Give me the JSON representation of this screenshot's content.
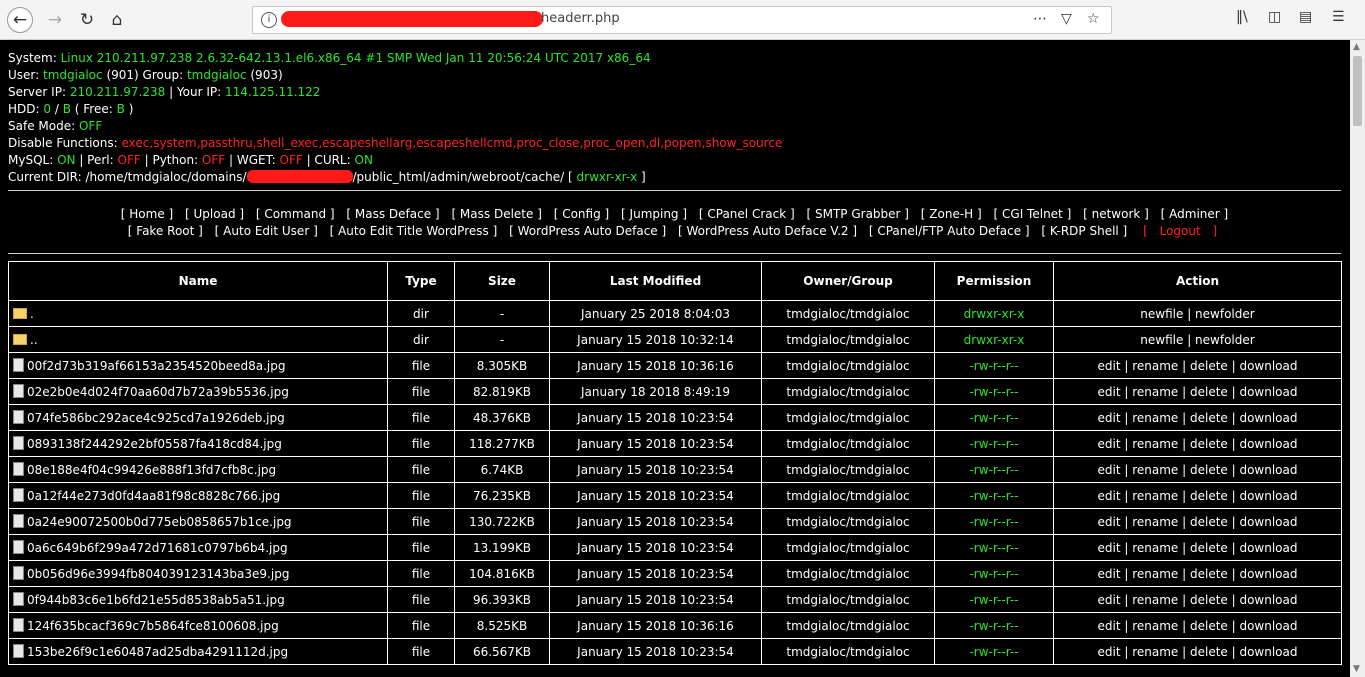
{
  "browser": {
    "url_suffix": "headerr.php",
    "icons": [
      "back-icon",
      "forward-icon",
      "reload-icon",
      "home-icon",
      "info-icon",
      "more-icon",
      "pocket-icon",
      "star-icon",
      "library-icon",
      "sidebar-icon",
      "reader-icon",
      "menu-icon"
    ]
  },
  "info": {
    "system_label": "System:",
    "system_value": "Linux 210.211.97.238 2.6.32-642.13.1.el6.x86_64 #1 SMP Wed Jan 11 20:56:24 UTC 2017 x86_64",
    "user_label": "User:",
    "user_value": "tmdgialoc",
    "user_id": "(901)",
    "group_label": "Group:",
    "group_value": "tmdgialoc",
    "group_id": "(903)",
    "server_ip_label": "Server IP:",
    "server_ip_value": "210.211.97.238",
    "your_ip_label": "| Your IP:",
    "your_ip_value": "114.125.11.122",
    "hdd_label": "HDD:",
    "hdd_used": "0",
    "hdd_sep": "/",
    "hdd_total": "B",
    "hdd_free_label": "( Free:",
    "hdd_free": "B",
    "hdd_close": ")",
    "safe_mode_label": "Safe Mode:",
    "safe_mode_value": "OFF",
    "disable_label": "Disable Functions:",
    "disable_value": "exec,system,passthru,shell_exec,escapeshellarg,escapeshellcmd,proc_close,proc_open,dl,popen,show_source",
    "mysql_label": "MySQL:",
    "mysql_value": "ON",
    "perl_label": "| Perl:",
    "perl_value": "OFF",
    "python_label": "| Python:",
    "python_value": "OFF",
    "wget_label": "| WGET:",
    "wget_value": "OFF",
    "curl_label": "| CURL:",
    "curl_value": "ON",
    "dir_label": "Current DIR:",
    "dir_prefix": "/home/tmdgialoc/domains/",
    "dir_suffix": "/public_html/admin/webroot/cache/",
    "dir_open": "[",
    "dir_perm": "drwxr-xr-x",
    "dir_close": "]"
  },
  "menu_row1": [
    "[ Home ]",
    "[ Upload ]",
    "[ Command ]",
    "[ Mass Deface ]",
    "[ Mass Delete ]",
    "[ Config ]",
    "[ Jumping ]",
    "[ CPanel Crack ]",
    "[ SMTP Grabber ]",
    "[ Zone-H ]",
    "[ CGI Telnet ]",
    "[ network ]",
    "[ Adminer ]"
  ],
  "menu_row2": [
    "[ Fake Root ]",
    "[ Auto Edit User ]",
    "[ Auto Edit Title WordPress ]",
    "[ WordPress Auto Deface ]",
    "[ WordPress Auto Deface V.2 ]",
    "[ CPanel/FTP Auto Deface ]",
    "[ K-RDP Shell ]"
  ],
  "logout": {
    "open": "[",
    "label": "Logout",
    "close": "]"
  },
  "table": {
    "headers": [
      "Name",
      "Type",
      "Size",
      "Last Modified",
      "Owner/Group",
      "Permission",
      "Action"
    ],
    "rows": [
      {
        "name": ".",
        "type": "dir",
        "size": "-",
        "modified": "January 25 2018 8:04:03",
        "owner": "tmdgialoc/tmdgialoc",
        "perm": "drwxr-xr-x",
        "action": "newfile | newfolder"
      },
      {
        "name": "..",
        "type": "dir",
        "size": "-",
        "modified": "January 15 2018 10:32:14",
        "owner": "tmdgialoc/tmdgialoc",
        "perm": "drwxr-xr-x",
        "action": "newfile | newfolder"
      },
      {
        "name": "00f2d73b319af66153a2354520beed8a.jpg",
        "type": "file",
        "size": "8.305KB",
        "modified": "January 15 2018 10:36:16",
        "owner": "tmdgialoc/tmdgialoc",
        "perm": "-rw-r--r--",
        "action": "edit | rename | delete | download"
      },
      {
        "name": "02e2b0e4d024f70aa60d7b72a39b5536.jpg",
        "type": "file",
        "size": "82.819KB",
        "modified": "January 18 2018 8:49:19",
        "owner": "tmdgialoc/tmdgialoc",
        "perm": "-rw-r--r--",
        "action": "edit | rename | delete | download"
      },
      {
        "name": "074fe586bc292ace4c925cd7a1926deb.jpg",
        "type": "file",
        "size": "48.376KB",
        "modified": "January 15 2018 10:23:54",
        "owner": "tmdgialoc/tmdgialoc",
        "perm": "-rw-r--r--",
        "action": "edit | rename | delete | download"
      },
      {
        "name": "0893138f244292e2bf05587fa418cd84.jpg",
        "type": "file",
        "size": "118.277KB",
        "modified": "January 15 2018 10:23:54",
        "owner": "tmdgialoc/tmdgialoc",
        "perm": "-rw-r--r--",
        "action": "edit | rename | delete | download"
      },
      {
        "name": "08e188e4f04c99426e888f13fd7cfb8c.jpg",
        "type": "file",
        "size": "6.74KB",
        "modified": "January 15 2018 10:23:54",
        "owner": "tmdgialoc/tmdgialoc",
        "perm": "-rw-r--r--",
        "action": "edit | rename | delete | download"
      },
      {
        "name": "0a12f44e273d0fd4aa81f98c8828c766.jpg",
        "type": "file",
        "size": "76.235KB",
        "modified": "January 15 2018 10:23:54",
        "owner": "tmdgialoc/tmdgialoc",
        "perm": "-rw-r--r--",
        "action": "edit | rename | delete | download"
      },
      {
        "name": "0a24e90072500b0d775eb0858657b1ce.jpg",
        "type": "file",
        "size": "130.722KB",
        "modified": "January 15 2018 10:23:54",
        "owner": "tmdgialoc/tmdgialoc",
        "perm": "-rw-r--r--",
        "action": "edit | rename | delete | download"
      },
      {
        "name": "0a6c649b6f299a472d71681c0797b6b4.jpg",
        "type": "file",
        "size": "13.199KB",
        "modified": "January 15 2018 10:23:54",
        "owner": "tmdgialoc/tmdgialoc",
        "perm": "-rw-r--r--",
        "action": "edit | rename | delete | download"
      },
      {
        "name": "0b056d96e3994fb804039123143ba3e9.jpg",
        "type": "file",
        "size": "104.816KB",
        "modified": "January 15 2018 10:23:54",
        "owner": "tmdgialoc/tmdgialoc",
        "perm": "-rw-r--r--",
        "action": "edit | rename | delete | download"
      },
      {
        "name": "0f944b83c6e1b6fd21e55d8538ab5a51.jpg",
        "type": "file",
        "size": "96.393KB",
        "modified": "January 15 2018 10:23:54",
        "owner": "tmdgialoc/tmdgialoc",
        "perm": "-rw-r--r--",
        "action": "edit | rename | delete | download"
      },
      {
        "name": "124f635bcacf369c7b5864fce8100608.jpg",
        "type": "file",
        "size": "8.525KB",
        "modified": "January 15 2018 10:36:16",
        "owner": "tmdgialoc/tmdgialoc",
        "perm": "-rw-r--r--",
        "action": "edit | rename | delete | download"
      },
      {
        "name": "153be26f9c1e60487ad25dba4291112d.jpg",
        "type": "file",
        "size": "66.567KB",
        "modified": "January 15 2018 10:23:54",
        "owner": "tmdgialoc/tmdgialoc",
        "perm": "-rw-r--r--",
        "action": "edit | rename | delete | download"
      }
    ]
  }
}
